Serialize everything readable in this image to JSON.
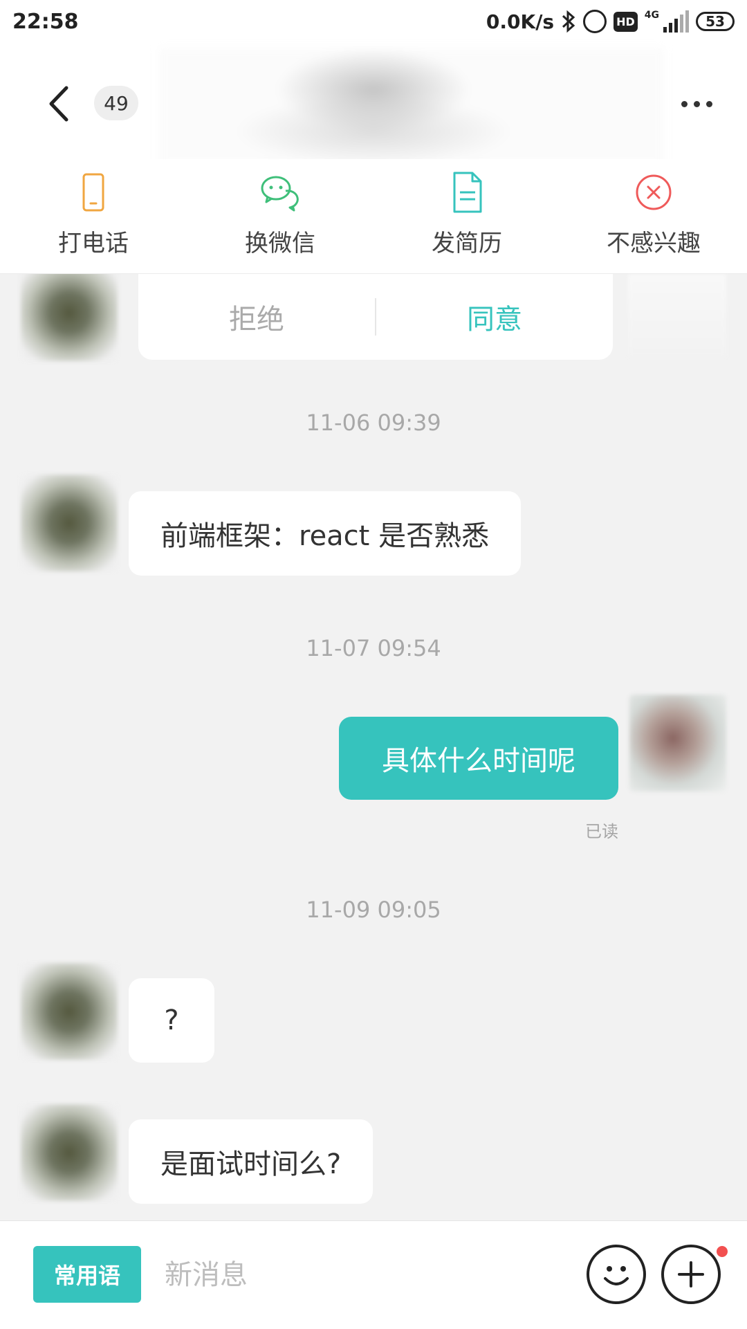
{
  "status_bar": {
    "time": "22:58",
    "net_speed": "0.0K/s",
    "hd_label": "HD",
    "network_type": "4G",
    "battery": "53"
  },
  "header": {
    "unread_count": "49"
  },
  "actions": [
    {
      "label": "打电话",
      "icon": "phone-icon",
      "color": "#f0a640"
    },
    {
      "label": "换微信",
      "icon": "wechat-icon",
      "color": "#3fbf7a"
    },
    {
      "label": "发简历",
      "icon": "resume-icon",
      "color": "#36c3bd"
    },
    {
      "label": "不感兴趣",
      "icon": "close-circle-icon",
      "color": "#ef5a5a"
    }
  ],
  "invite": {
    "reject": "拒绝",
    "accept": "同意"
  },
  "messages": [
    {
      "timestamp": "11-06 09:39"
    },
    {
      "text": "前端框架：react 是否熟悉",
      "from": "other"
    },
    {
      "timestamp": "11-07 09:54"
    },
    {
      "text": "具体什么时间呢",
      "from": "me",
      "status": "已读"
    },
    {
      "timestamp": "11-09 09:05"
    },
    {
      "text": "?",
      "from": "other"
    },
    {
      "text": "是面试时间么?",
      "from": "other"
    }
  ],
  "input": {
    "quick_reply": "常用语",
    "placeholder": "新消息"
  },
  "colors": {
    "accent": "#36c3bd",
    "background": "#f2f2f2",
    "notification_dot": "#f25050"
  }
}
